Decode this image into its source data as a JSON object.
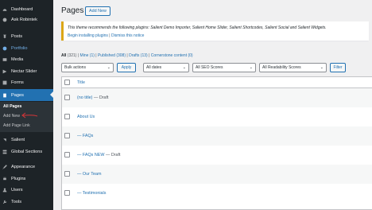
{
  "sidebar": {
    "items": [
      {
        "label": "Dashboard",
        "icon": "dashboard-icon"
      },
      {
        "label": "Ask Robintek",
        "icon": "question-icon"
      },
      {
        "label": "Posts",
        "icon": "pin-icon"
      },
      {
        "label": "Portfolio",
        "icon": "portfolio-icon"
      },
      {
        "label": "Media",
        "icon": "media-icon"
      },
      {
        "label": "Nectar Slider",
        "icon": "slider-icon"
      },
      {
        "label": "Forms",
        "icon": "forms-icon"
      },
      {
        "label": "Pages",
        "icon": "pages-icon"
      },
      {
        "label": "Salient",
        "icon": "salient-icon"
      },
      {
        "label": "Global Sections",
        "icon": "global-sections-icon"
      },
      {
        "label": "Appearance",
        "icon": "brush-icon"
      },
      {
        "label": "Plugins",
        "icon": "plugin-icon"
      },
      {
        "label": "Users",
        "icon": "users-icon"
      },
      {
        "label": "Tools",
        "icon": "wrench-icon"
      }
    ],
    "submenu": [
      "All Pages",
      "Add New",
      "Add Page Link"
    ]
  },
  "header": {
    "title": "Pages",
    "add_new": "Add New"
  },
  "notice": {
    "text": "This theme recommends the following plugins: Salient Demo Importer, Salient Home Slider, Salient Shortcodes, Salient Social and Salient Widgets.",
    "link1": "Begin installing plugins",
    "sep": " | ",
    "link2": "Dismiss this notice"
  },
  "views": {
    "all": "All",
    "all_count": "(321)",
    "mine": "Mine (1)",
    "published": "Published (308)",
    "drafts": "Drafts (13)",
    "cornerstone": "Cornerstone content (0)",
    "sep": " | "
  },
  "filters": {
    "bulk": "Bulk actions",
    "apply": "Apply",
    "dates": "All dates",
    "seo": "All SEO Scores",
    "readability": "All Readability Scores",
    "filter": "Filter"
  },
  "table": {
    "header": "Title",
    "rows": [
      {
        "title": "(no title)",
        "state": " — Draft"
      },
      {
        "title": "About Us",
        "state": ""
      },
      {
        "title": "— FAQs",
        "state": ""
      },
      {
        "title": "— FAQs NEW",
        "state": " — Draft"
      },
      {
        "title": "— Our Team",
        "state": ""
      },
      {
        "title": "— Testimonials",
        "state": ""
      }
    ]
  },
  "colors": {
    "sidebar": "#1d2327",
    "accent": "#2271b1",
    "notice": "#dba617",
    "arrow": "#d63638"
  }
}
